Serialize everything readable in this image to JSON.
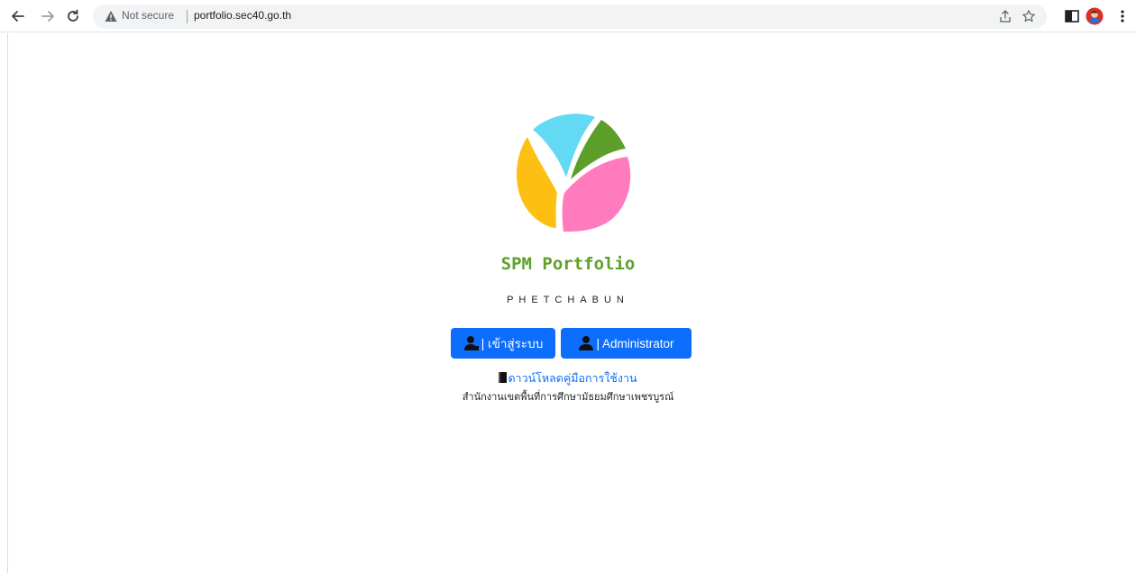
{
  "browser": {
    "security_label": "Not secure",
    "url": "portfolio.sec40.go.th",
    "icons": [
      "back-arrow-icon",
      "forward-arrow-icon",
      "reload-icon",
      "warning-icon",
      "share-icon",
      "star-icon",
      "side-panel-icon",
      "profile-avatar-icon",
      "more-menu-icon"
    ]
  },
  "page": {
    "title": "SPM Portfolio",
    "subtitle": "PHETCHABUN",
    "login_button": "| เข้าสู่ระบบ",
    "admin_button": "| Administrator",
    "download_link": "ดาวน์โหลดคู่มือการใช้งาน",
    "office_name": "สำนักงานเขตพื้นที่การศึกษามัธยมศึกษาเพชรบูรณ์"
  },
  "colors": {
    "title_green": "#5da02b",
    "button_blue": "#0d6efd",
    "logo_yellow": "#fdbf12",
    "logo_cyan": "#63d9f4",
    "logo_green": "#5d9e2a",
    "logo_pink": "#ff7bbd"
  }
}
